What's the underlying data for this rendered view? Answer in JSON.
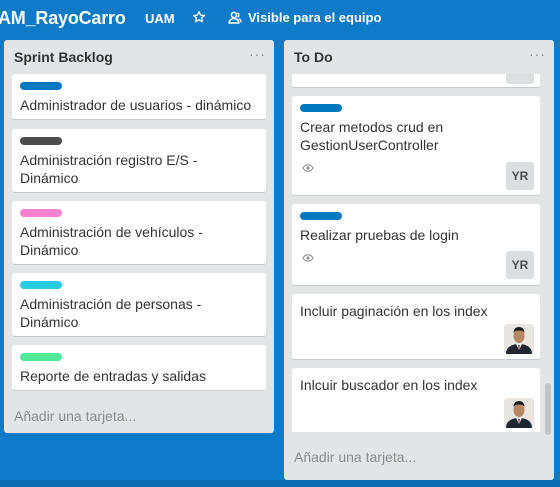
{
  "header": {
    "board_title": "AM_RayoCarro",
    "team": "UAM",
    "visibility": "Visible para el equipo",
    "star_icon": "star-icon",
    "team_icon": "people-icon"
  },
  "colors": {
    "background": "#0f7ac7",
    "list_bg": "#e2e4e6",
    "label_blue": "#0079bf",
    "label_dark": "#4d4d4d",
    "label_pink": "#ff80ce",
    "label_cyan": "#29cce5",
    "label_green": "#51e898"
  },
  "lists": [
    {
      "title": "Sprint Backlog",
      "menu": "···",
      "add_card": "Añadir una tarjeta...",
      "cards": [
        {
          "label_color": "#0079bf",
          "title": "Administrador de usuarios - dinámico"
        },
        {
          "label_color": "#4d4d4d",
          "title": "Administración registro E/S - Dinámico"
        },
        {
          "label_color": "#ff80ce",
          "title": "Administración de vehículos - Dinámico"
        },
        {
          "label_color": "#29cce5",
          "title": "Administración de personas - Dinámico"
        },
        {
          "label_color": "#51e898",
          "title": "Reporte de entradas y salidas"
        }
      ]
    },
    {
      "title": "To Do",
      "menu": "···",
      "add_card": "Añadir una tarjeta...",
      "cards": [
        {
          "title": "",
          "member": ""
        },
        {
          "label_color": "#0079bf",
          "title": "Crear metodos crud en GestionUserController",
          "member": "YR",
          "watch_icon": "eye-icon"
        },
        {
          "label_color": "#0079bf",
          "title": "Realizar pruebas de login",
          "member": "YR",
          "watch_icon": "eye-icon"
        },
        {
          "title": "Incluir paginación en los index",
          "member_avatar": "user-photo"
        },
        {
          "title": "Inlcuir buscador en los index",
          "member_avatar": "user-photo"
        }
      ]
    }
  ]
}
